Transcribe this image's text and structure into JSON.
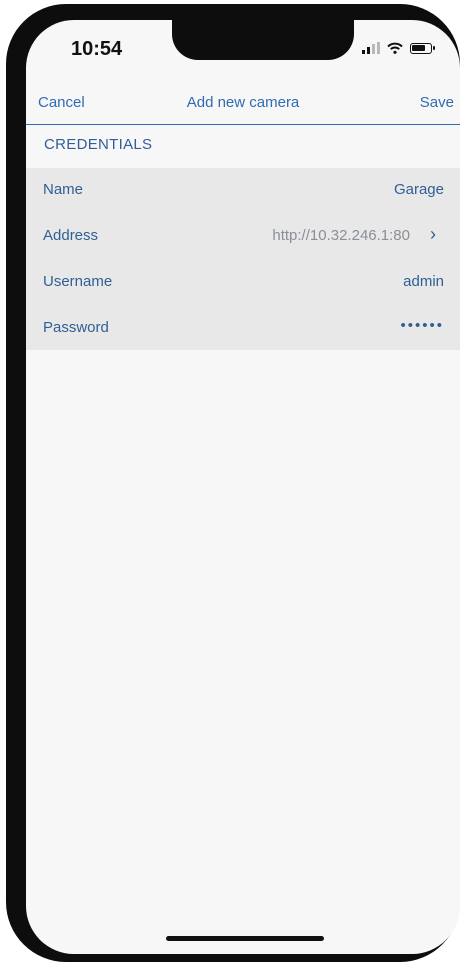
{
  "status_bar": {
    "time": "10:54"
  },
  "navbar": {
    "cancel_label": "Cancel",
    "title": "Add new camera",
    "save_label": "Save"
  },
  "section": {
    "header": "CREDENTIALS"
  },
  "fields": [
    {
      "label": "Name",
      "value": "Garage"
    },
    {
      "label": "Address",
      "value": "http://10.32.246.1:80",
      "chevron": "›"
    },
    {
      "label": "Username",
      "value": "admin"
    },
    {
      "label": "Password",
      "value": "••••••"
    }
  ],
  "colors": {
    "accent": "#2f6db0",
    "label": "#2f5f94",
    "list_background": "#e8e8e8",
    "muted_value": "#8a8f96"
  }
}
